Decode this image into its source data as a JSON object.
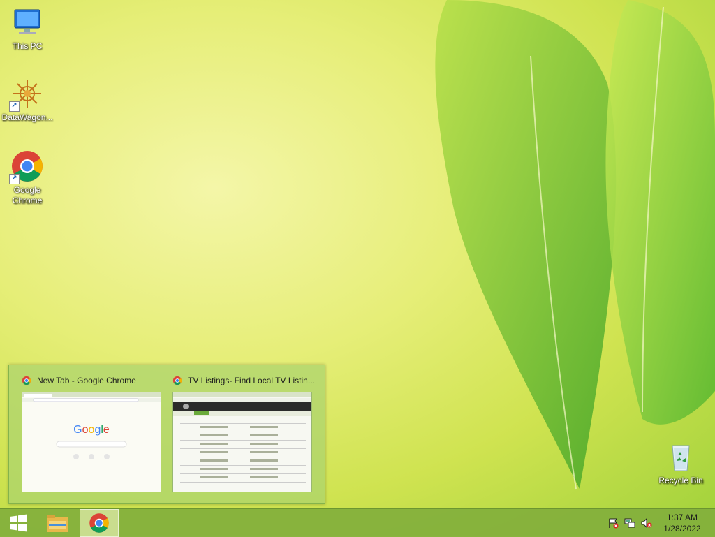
{
  "desktop": {
    "icons": [
      {
        "label": "This PC"
      },
      {
        "label": "DataWagon..."
      },
      {
        "label": "Google Chrome"
      },
      {
        "label": "Recycle Bin"
      }
    ]
  },
  "preview": {
    "windows": [
      {
        "title": "New Tab - Google Chrome"
      },
      {
        "title": "TV Listings- Find Local TV Listin..."
      }
    ]
  },
  "taskbar": {
    "clock": {
      "time": "1:37 AM",
      "date": "1/28/2022"
    }
  },
  "colors": {
    "wallpaper": "#d6e95a",
    "taskbar": "#82af3c",
    "leaf": "#6fbf2a"
  }
}
